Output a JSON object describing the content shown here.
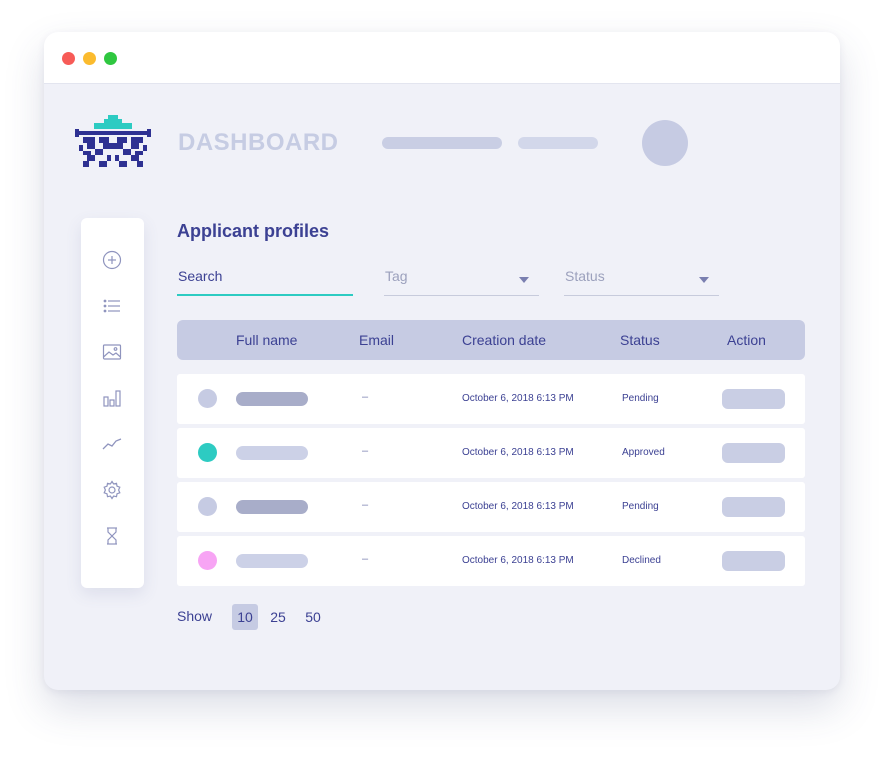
{
  "window": {
    "controls": [
      "close",
      "minimize",
      "maximize"
    ]
  },
  "header": {
    "app_title": "DASHBOARD",
    "logo_icon": "space-invader-logo-icon",
    "avatar_icon": "user-avatar-icon"
  },
  "sidebar": {
    "items": [
      {
        "icon": "add-circle-icon"
      },
      {
        "icon": "list-icon"
      },
      {
        "icon": "image-icon"
      },
      {
        "icon": "bar-chart-icon"
      },
      {
        "icon": "line-chart-icon"
      },
      {
        "icon": "gear-icon"
      },
      {
        "icon": "hourglass-icon"
      }
    ]
  },
  "main": {
    "section_title": "Applicant profiles",
    "filters": {
      "search_label": "Search",
      "tag_label": "Tag",
      "status_label": "Status"
    },
    "table": {
      "columns": [
        "Full name",
        "Email",
        "Creation date",
        "Status",
        "Action"
      ],
      "rows": [
        {
          "email": "–",
          "created": "October 6, 2018 6:13 PM",
          "status": "Pending",
          "status_color": "#c6cbe3",
          "name_bar_color": "#a8adc9"
        },
        {
          "email": "–",
          "created": "October 6, 2018 6:13 PM",
          "status": "Approved",
          "status_color": "#2dcbc2",
          "name_bar_color": "#ccd1e7"
        },
        {
          "email": "–",
          "created": "October 6, 2018 6:13 PM",
          "status": "Pending",
          "status_color": "#c6cbe3",
          "name_bar_color": "#a8adc9"
        },
        {
          "email": "–",
          "created": "October 6, 2018 6:13 PM",
          "status": "Declined",
          "status_color": "#f7a4f4",
          "name_bar_color": "#ccd1e7"
        }
      ]
    },
    "pagination": {
      "show_label": "Show",
      "options": [
        "10",
        "25",
        "50"
      ],
      "selected": "10"
    }
  },
  "colors": {
    "accent": "#2dcbc2",
    "primary_text": "#3c4193",
    "muted": "#c6cbe3",
    "background": "#f0f1f8"
  }
}
